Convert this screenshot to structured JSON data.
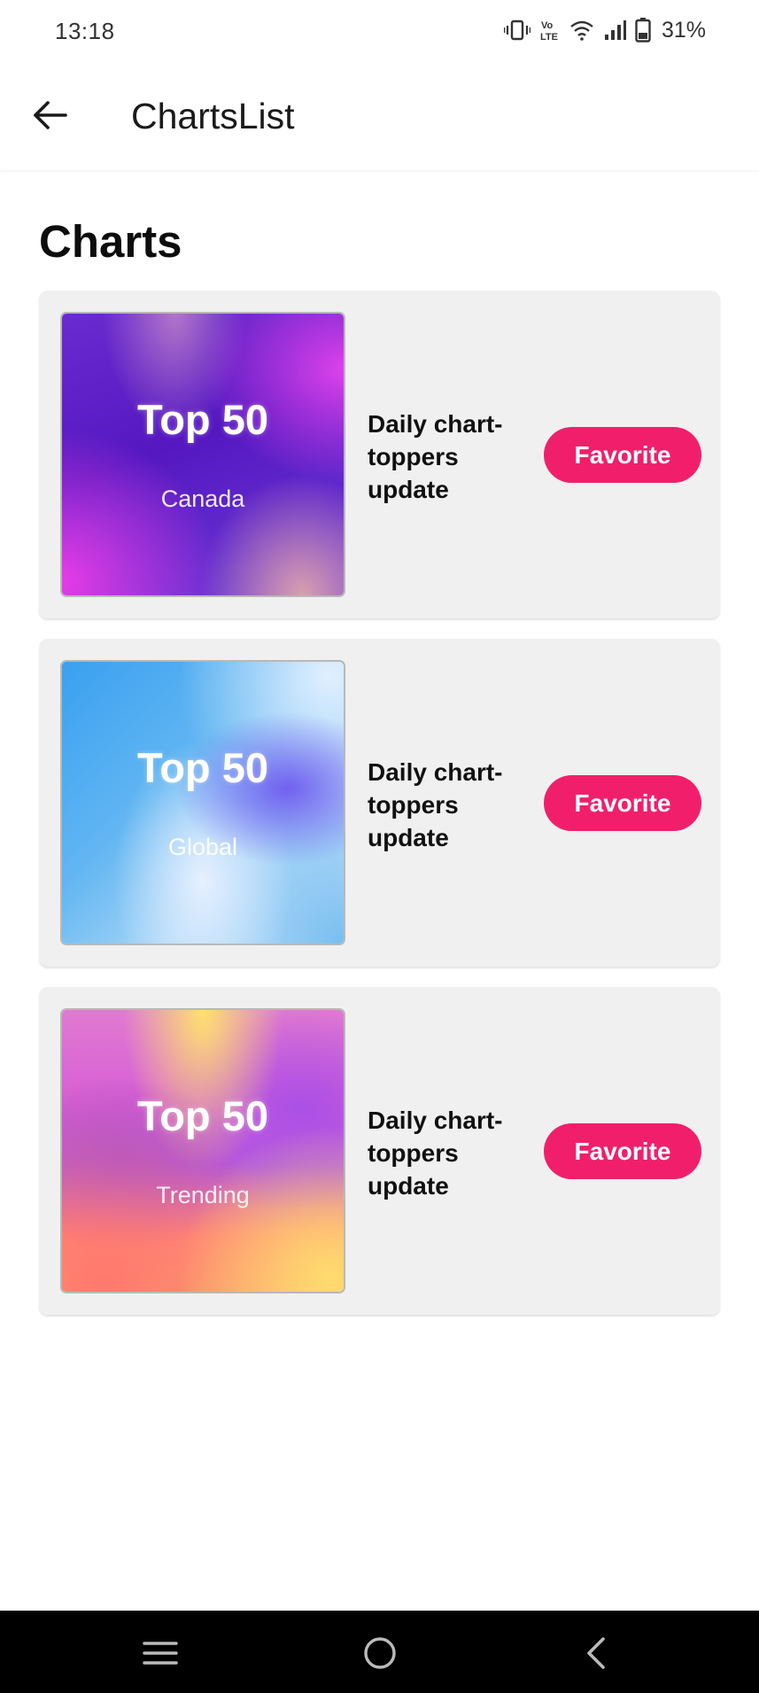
{
  "status_bar": {
    "time": "13:18",
    "battery_percent": "31%",
    "icons": [
      "vibrate-icon",
      "volte-icon",
      "wifi-icon",
      "signal-icon",
      "battery-icon"
    ]
  },
  "app_bar": {
    "back_icon": "arrow-left-icon",
    "title": "ChartsList"
  },
  "section_title": "Charts",
  "charts": [
    {
      "cover_title": "Top 50",
      "cover_subtitle": "Canada",
      "description": "Daily chart-toppers update",
      "button_label": "Favorite"
    },
    {
      "cover_title": "Top 50",
      "cover_subtitle": "Global",
      "description": "Daily chart-toppers update",
      "button_label": "Favorite"
    },
    {
      "cover_title": "Top 50",
      "cover_subtitle": "Trending",
      "description": "Daily chart-toppers update",
      "button_label": "Favorite"
    }
  ],
  "nav_bar": {
    "icons": [
      "menu-icon",
      "home-icon",
      "back-icon"
    ]
  },
  "colors": {
    "accent": "#f11f6b",
    "card_background": "#f0f0f0",
    "nav_background": "#000000"
  }
}
